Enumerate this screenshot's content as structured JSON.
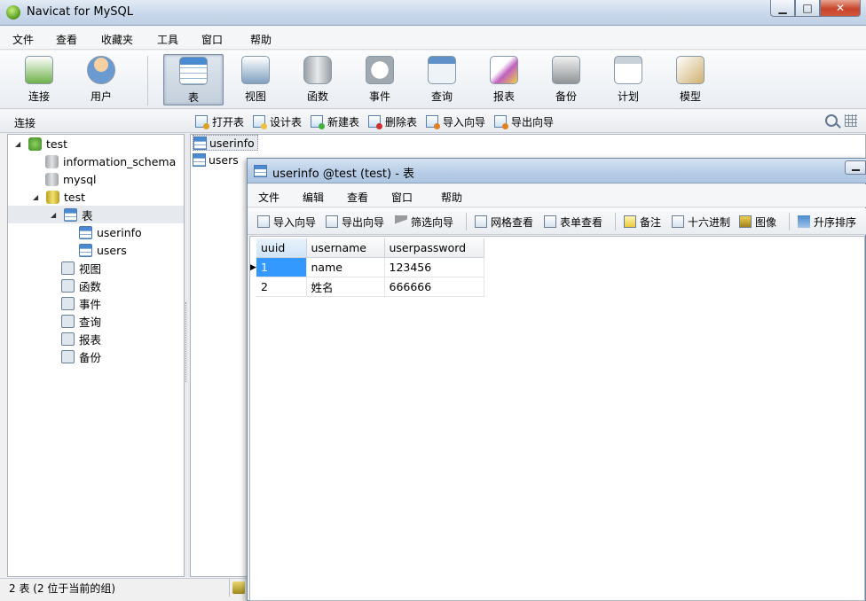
{
  "main_window": {
    "title": "Navicat for MySQL",
    "controls": {
      "minimize": "▁",
      "maximize": "□",
      "close": "✕"
    },
    "menu": [
      "文件",
      "查看",
      "收藏夹",
      "工具",
      "窗口",
      "帮助"
    ],
    "toolbar": [
      {
        "label": "连接",
        "icon": "connection-icon",
        "color": "#6fb04a"
      },
      {
        "label": "用户",
        "icon": "user-icon",
        "color": "#e0a85a"
      },
      {
        "label": "表",
        "icon": "table-icon",
        "color": "#4a8ad0",
        "active": true
      },
      {
        "label": "视图",
        "icon": "view-icon",
        "color": "#7fa0c0"
      },
      {
        "label": "函数",
        "icon": "function-icon",
        "color": "#e8a030"
      },
      {
        "label": "事件",
        "icon": "event-icon",
        "color": "#a0a8b0"
      },
      {
        "label": "查询",
        "icon": "query-icon",
        "color": "#6090c8"
      },
      {
        "label": "报表",
        "icon": "report-icon",
        "color": "#c060c0"
      },
      {
        "label": "备份",
        "icon": "backup-icon",
        "color": "#909498"
      },
      {
        "label": "计划",
        "icon": "schedule-icon",
        "color": "#b0b8c0"
      },
      {
        "label": "模型",
        "icon": "model-icon",
        "color": "#d0b070"
      }
    ],
    "sub_header": {
      "label": "连接",
      "actions": [
        "打开表",
        "设计表",
        "新建表",
        "删除表",
        "导入向导",
        "导出向导"
      ]
    },
    "tree": {
      "connection": "test",
      "databases": [
        "information_schema",
        "mysql",
        "test"
      ],
      "tables_group": "表",
      "tables": [
        "userinfo",
        "users"
      ],
      "others": [
        "视图",
        "函数",
        "事件",
        "查询",
        "报表",
        "备份"
      ]
    },
    "object_list": [
      "userinfo",
      "users"
    ],
    "status": "2 表 (2 位于当前的组)"
  },
  "child_window": {
    "title": "userinfo @test (test) - 表",
    "menu": [
      "文件",
      "编辑",
      "查看",
      "窗口",
      "帮助"
    ],
    "toolbar": [
      "导入向导",
      "导出向导",
      "筛选向导",
      "网格查看",
      "表单查看",
      "备注",
      "十六进制",
      "图像",
      "升序排序"
    ],
    "grid": {
      "columns": [
        "uuid",
        "username",
        "userpassword"
      ],
      "rows": [
        [
          "1",
          "name",
          "123456"
        ],
        [
          "2",
          "姓名",
          "666666"
        ]
      ]
    }
  }
}
